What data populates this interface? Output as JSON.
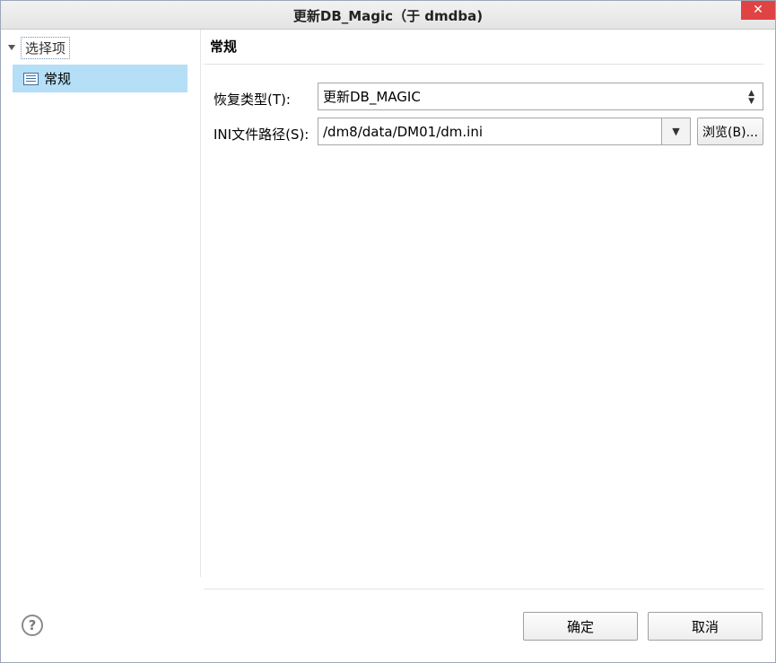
{
  "window": {
    "title": "更新DB_Magic（于 dmdba)",
    "close_glyph": "✕"
  },
  "tree": {
    "root_label": "选择项",
    "items": [
      {
        "label": "常规",
        "selected": true
      }
    ]
  },
  "section": {
    "title": "常规"
  },
  "form": {
    "recovery_type": {
      "label": "恢复类型(T):",
      "value": "更新DB_MAGIC"
    },
    "ini_path": {
      "label": "INI文件路径(S):",
      "value": "/dm8/data/DM01/dm.ini",
      "browse_label": "浏览(B)..."
    }
  },
  "footer": {
    "help_glyph": "?",
    "ok_label": "确定",
    "cancel_label": "取消"
  },
  "colors": {
    "selection": "#b5dff7",
    "close": "#e04343"
  }
}
